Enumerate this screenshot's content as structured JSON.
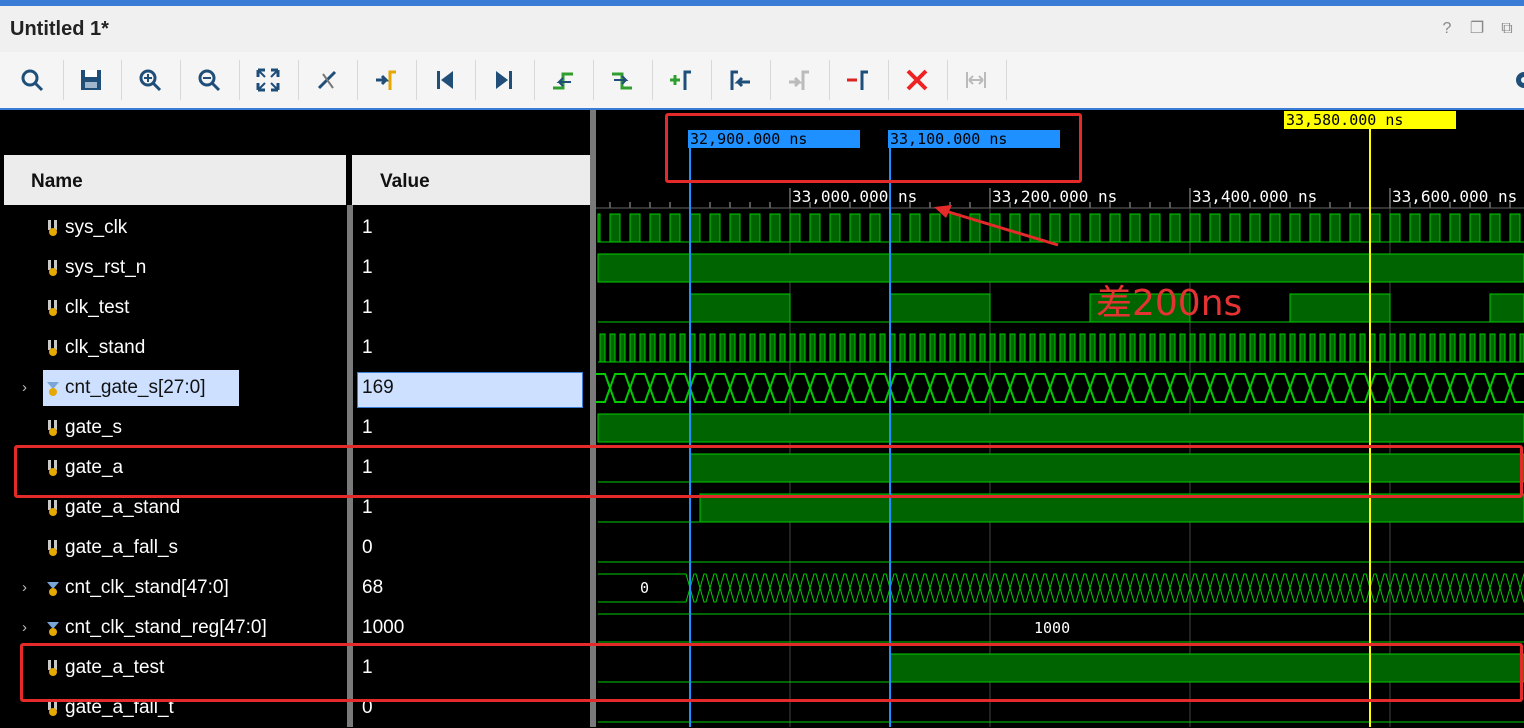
{
  "window": {
    "title": "Untitled 1*",
    "controls": [
      "help-icon",
      "restore-icon",
      "maximize-icon"
    ]
  },
  "toolbar": {
    "buttons": [
      {
        "name": "search-icon",
        "label": "Search"
      },
      {
        "name": "save-icon",
        "label": "Save Waveform Configuration"
      },
      {
        "name": "zoom-in-icon",
        "label": "Zoom In"
      },
      {
        "name": "zoom-out-icon",
        "label": "Zoom Out"
      },
      {
        "name": "zoom-fit-icon",
        "label": "Zoom Fit"
      },
      {
        "name": "zoom-to-cursor-icon",
        "label": "Zoom to Cursor"
      },
      {
        "name": "go-to-cursor-icon",
        "label": "Go to Cursor"
      },
      {
        "name": "go-to-time-zero-icon",
        "label": "Go to Time 0"
      },
      {
        "name": "go-to-last-time-icon",
        "label": "Go to Last Time"
      },
      {
        "name": "previous-transition-icon",
        "label": "Previous Transition"
      },
      {
        "name": "next-transition-icon",
        "label": "Next Transition"
      },
      {
        "name": "add-marker-icon",
        "label": "Add Marker"
      },
      {
        "name": "previous-marker-icon",
        "label": "Previous Marker"
      },
      {
        "name": "next-marker-icon",
        "label": "Next Marker"
      },
      {
        "name": "remove-marker-icon",
        "label": "Remove Marker"
      },
      {
        "name": "delete-icon",
        "label": "Delete All Markers"
      },
      {
        "name": "swap-cursors-icon",
        "label": "Swap Cursors"
      }
    ]
  },
  "columns": {
    "name": "Name",
    "value": "Value"
  },
  "signals": [
    {
      "name": "sys_clk",
      "value": "1",
      "expandable": false,
      "bus": false
    },
    {
      "name": "sys_rst_n",
      "value": "1",
      "expandable": false,
      "bus": false
    },
    {
      "name": "clk_test",
      "value": "1",
      "expandable": false,
      "bus": false
    },
    {
      "name": "clk_stand",
      "value": "1",
      "expandable": false,
      "bus": false
    },
    {
      "name": "cnt_gate_s[27:0]",
      "value": "169",
      "expandable": true,
      "bus": true,
      "selected": true
    },
    {
      "name": "gate_s",
      "value": "1",
      "expandable": false,
      "bus": false
    },
    {
      "name": "gate_a",
      "value": "1",
      "expandable": false,
      "bus": false
    },
    {
      "name": "gate_a_stand",
      "value": "1",
      "expandable": false,
      "bus": false
    },
    {
      "name": "gate_a_fall_s",
      "value": "0",
      "expandable": false,
      "bus": false
    },
    {
      "name": "cnt_clk_stand[47:0]",
      "value": "68",
      "expandable": true,
      "bus": true
    },
    {
      "name": "cnt_clk_stand_reg[47:0]",
      "value": "1000",
      "expandable": true,
      "bus": true
    },
    {
      "name": "gate_a_test",
      "value": "1",
      "expandable": false,
      "bus": false
    },
    {
      "name": "gate_a_fall_t",
      "value": "0",
      "expandable": false,
      "bus": false
    }
  ],
  "cursors": [
    {
      "label": "32,900.000 ns",
      "time_ns": 32900,
      "color": "#1e90ff"
    },
    {
      "label": "33,100.000 ns",
      "time_ns": 33100,
      "color": "#1e90ff"
    },
    {
      "label": "33,580.000 ns",
      "time_ns": 33580,
      "color": "#ffff00"
    }
  ],
  "timeline": {
    "ticks": [
      {
        "label": "33,000.000 ns",
        "time_ns": 33000
      },
      {
        "label": "33,200.000 ns",
        "time_ns": 33200
      },
      {
        "label": "33,400.000 ns",
        "time_ns": 33400
      },
      {
        "label": "33,600.000 ns",
        "time_ns": 33600
      }
    ]
  },
  "bus_labels": {
    "cnt_clk_stand_start": "0",
    "cnt_clk_stand_reg": "1000"
  },
  "annotation": {
    "text": "差200ns",
    "color": "#e53333"
  },
  "colors": {
    "wave_green": "#00cc00",
    "wave_fill": "#006400",
    "cursor_blue": "#1e90ff",
    "cursor_yellow": "#ffff00",
    "highlight_red": "#e52a2a"
  }
}
